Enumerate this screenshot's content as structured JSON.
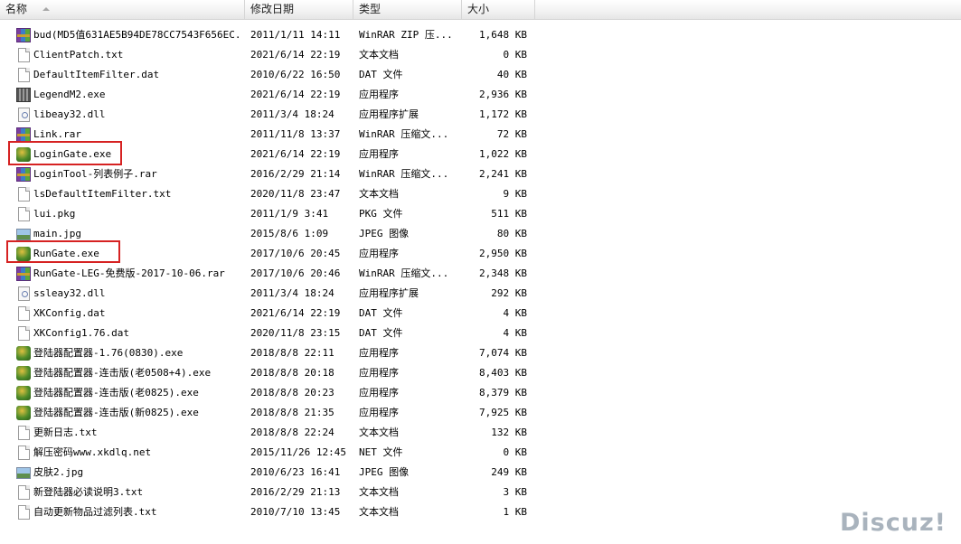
{
  "columns": {
    "name": "名称",
    "date": "修改日期",
    "type": "类型",
    "size": "大小"
  },
  "files": [
    {
      "name": "bud(MD5值631AE5B94DE78CC7543F656EC...",
      "date": "2011/1/11 14:11",
      "type": "WinRAR ZIP 压...",
      "size": "1,648 KB",
      "icon": "rar"
    },
    {
      "name": "ClientPatch.txt",
      "date": "2021/6/14 22:19",
      "type": "文本文档",
      "size": "0 KB",
      "icon": "file"
    },
    {
      "name": "DefaultItemFilter.dat",
      "date": "2010/6/22 16:50",
      "type": "DAT 文件",
      "size": "40 KB",
      "icon": "file"
    },
    {
      "name": "LegendM2.exe",
      "date": "2021/6/14 22:19",
      "type": "应用程序",
      "size": "2,936 KB",
      "icon": "legend"
    },
    {
      "name": "libeay32.dll",
      "date": "2011/3/4 18:24",
      "type": "应用程序扩展",
      "size": "1,172 KB",
      "icon": "dll"
    },
    {
      "name": "Link.rar",
      "date": "2011/11/8 13:37",
      "type": "WinRAR 压缩文...",
      "size": "72 KB",
      "icon": "rar"
    },
    {
      "name": "LoginGate.exe",
      "date": "2021/6/14 22:19",
      "type": "应用程序",
      "size": "1,022 KB",
      "icon": "exe"
    },
    {
      "name": "LoginTool-列表例子.rar",
      "date": "2016/2/29 21:14",
      "type": "WinRAR 压缩文...",
      "size": "2,241 KB",
      "icon": "rar"
    },
    {
      "name": "lsDefaultItemFilter.txt",
      "date": "2020/11/8 23:47",
      "type": "文本文档",
      "size": "9 KB",
      "icon": "file"
    },
    {
      "name": "lui.pkg",
      "date": "2011/1/9 3:41",
      "type": "PKG 文件",
      "size": "511 KB",
      "icon": "file"
    },
    {
      "name": "main.jpg",
      "date": "2015/8/6 1:09",
      "type": "JPEG 图像",
      "size": "80 KB",
      "icon": "jpg"
    },
    {
      "name": "RunGate.exe",
      "date": "2017/10/6 20:45",
      "type": "应用程序",
      "size": "2,950 KB",
      "icon": "exe"
    },
    {
      "name": "RunGate-LEG-免费版-2017-10-06.rar",
      "date": "2017/10/6 20:46",
      "type": "WinRAR 压缩文...",
      "size": "2,348 KB",
      "icon": "rar"
    },
    {
      "name": "ssleay32.dll",
      "date": "2011/3/4 18:24",
      "type": "应用程序扩展",
      "size": "292 KB",
      "icon": "dll"
    },
    {
      "name": "XKConfig.dat",
      "date": "2021/6/14 22:19",
      "type": "DAT 文件",
      "size": "4 KB",
      "icon": "file"
    },
    {
      "name": "XKConfig1.76.dat",
      "date": "2020/11/8 23:15",
      "type": "DAT 文件",
      "size": "4 KB",
      "icon": "file"
    },
    {
      "name": "登陆器配置器-1.76(0830).exe",
      "date": "2018/8/8 22:11",
      "type": "应用程序",
      "size": "7,074 KB",
      "icon": "exe"
    },
    {
      "name": "登陆器配置器-连击版(老0508+4).exe",
      "date": "2018/8/8 20:18",
      "type": "应用程序",
      "size": "8,403 KB",
      "icon": "exe"
    },
    {
      "name": "登陆器配置器-连击版(老0825).exe",
      "date": "2018/8/8 20:23",
      "type": "应用程序",
      "size": "8,379 KB",
      "icon": "exe"
    },
    {
      "name": "登陆器配置器-连击版(新0825).exe",
      "date": "2018/8/8 21:35",
      "type": "应用程序",
      "size": "7,925 KB",
      "icon": "exe"
    },
    {
      "name": "更新日志.txt",
      "date": "2018/8/8 22:24",
      "type": "文本文档",
      "size": "132 KB",
      "icon": "file"
    },
    {
      "name": "解压密码www.xkdlq.net",
      "date": "2015/11/26 12:45",
      "type": "NET 文件",
      "size": "0 KB",
      "icon": "file"
    },
    {
      "name": "皮肤2.jpg",
      "date": "2010/6/23 16:41",
      "type": "JPEG 图像",
      "size": "249 KB",
      "icon": "jpg"
    },
    {
      "name": "新登陆器必读说明3.txt",
      "date": "2016/2/29 21:13",
      "type": "文本文档",
      "size": "3 KB",
      "icon": "file"
    },
    {
      "name": "自动更新物品过滤列表.txt",
      "date": "2010/7/10 13:45",
      "type": "文本文档",
      "size": "1 KB",
      "icon": "file"
    }
  ],
  "watermark": "Discuz!"
}
